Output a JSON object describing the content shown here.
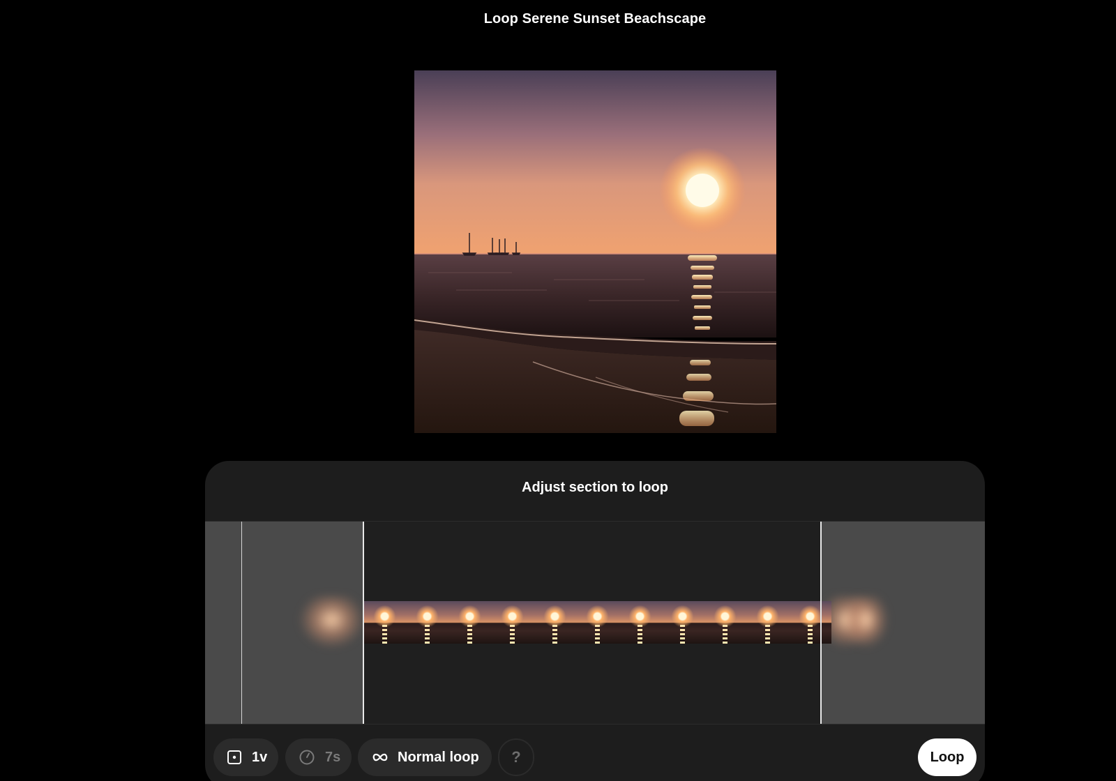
{
  "page": {
    "title": "Loop Serene Sunset Beachscape"
  },
  "preview": {
    "icon": "sunset-beach-image"
  },
  "panel": {
    "title": "Adjust section to loop",
    "filmstrip_frame_count": 11
  },
  "toolbar": {
    "variations_label": "1v",
    "variations_icon": "dice-icon",
    "duration_label": "7s",
    "duration_icon": "clock-icon",
    "mode_label": "Normal loop",
    "mode_icon": "infinity-icon",
    "help_label": "?",
    "loop_button_label": "Loop"
  },
  "colors": {
    "background": "#000000",
    "panel": "#1d1d1d",
    "chip": "#2b2b2b",
    "dimmed_region": "#4a4a4a",
    "primary_button": "#ffffff"
  }
}
